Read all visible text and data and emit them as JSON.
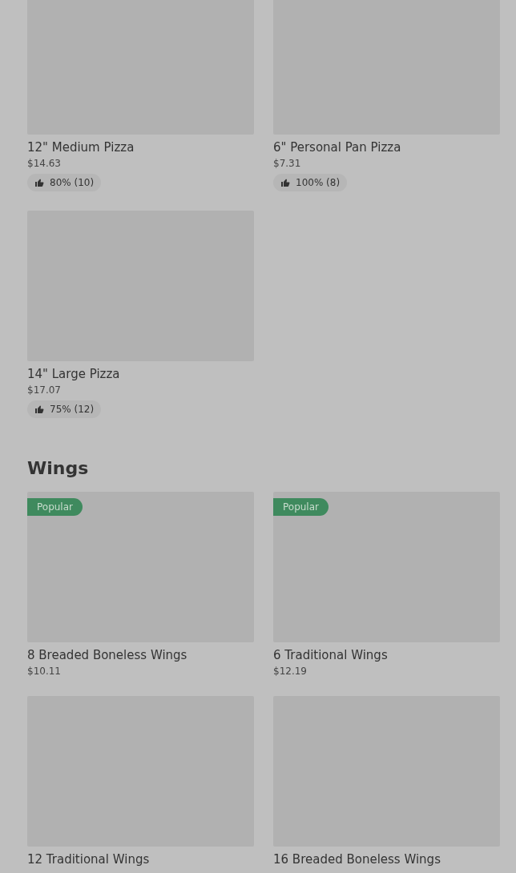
{
  "sections": [
    {
      "items": [
        {
          "name": "12\" Medium Pizza",
          "price": "$14.63",
          "rating": "80% (10)"
        },
        {
          "name": "6\" Personal Pan Pizza",
          "price": "$7.31",
          "rating": "100% (8)"
        },
        {
          "name": "14\" Large Pizza",
          "price": "$17.07",
          "rating": "75% (12)"
        }
      ]
    },
    {
      "title": "Wings",
      "items": [
        {
          "name": "8 Breaded Boneless Wings",
          "price": "$10.11",
          "badge": "Popular"
        },
        {
          "name": "6 Traditional Wings",
          "price": "$12.19",
          "badge": "Popular"
        },
        {
          "name": "12 Traditional Wings"
        },
        {
          "name": "16 Breaded Boneless Wings"
        }
      ]
    }
  ]
}
